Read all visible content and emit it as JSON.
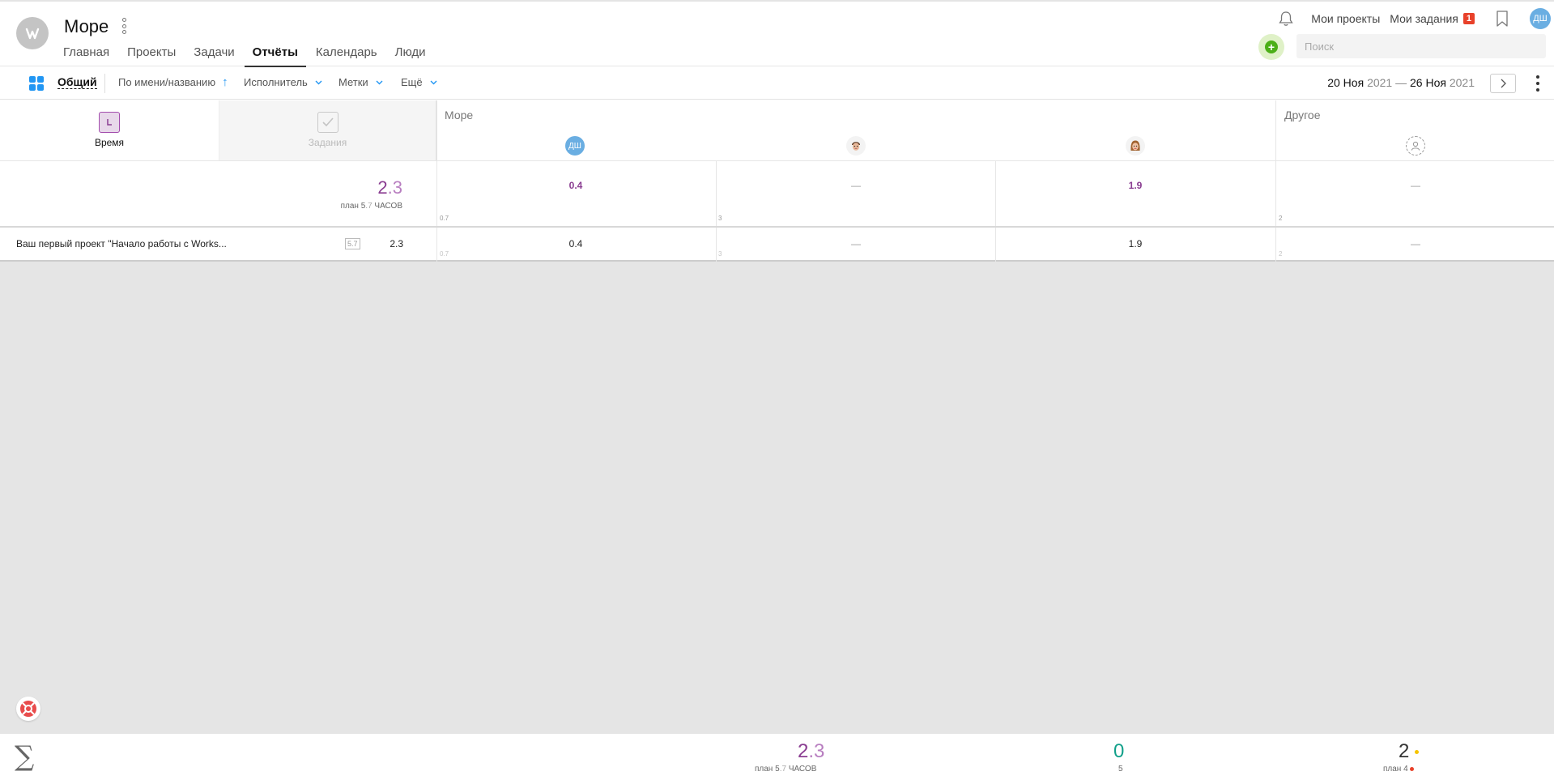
{
  "header": {
    "workspace_name": "Море",
    "nav": [
      "Главная",
      "Проекты",
      "Задачи",
      "Отчёты",
      "Календарь",
      "Люди"
    ],
    "active_nav": "Отчёты",
    "my_projects": "Мои проекты",
    "my_tasks": "Мои задания",
    "my_tasks_badge": "1",
    "user_initials": "ДШ",
    "search_placeholder": "Поиск"
  },
  "toolbar": {
    "view": "Общий",
    "sort": "По имени/названию",
    "filter_assignee": "Исполнитель",
    "filter_tags": "Метки",
    "more": "Ещё",
    "date_from_day": "20 Ноя",
    "date_from_year": "2021",
    "date_sep": "—",
    "date_to_day": "26 Ноя",
    "date_to_year": "2021"
  },
  "report": {
    "mode_time": "Время",
    "mode_tasks": "Задания",
    "group_main": "Море",
    "group_other": "Другое",
    "col_user_initials": "ДШ",
    "total_int": "2",
    "total_dec": ".3",
    "total_plan_label": "план",
    "total_plan_int": "5",
    "total_plan_dec": ".7",
    "total_unit": "ЧАСОВ",
    "summary_cells": [
      {
        "value": "0.4",
        "plan": "0.7"
      },
      {
        "value": "—",
        "plan": "3"
      },
      {
        "value": "1.9",
        "plan": ""
      },
      {
        "value": "—",
        "plan": "2"
      }
    ],
    "rows": [
      {
        "name": "Ваш первый проект \"Начало работы с Works...",
        "plan": "5.7",
        "total": "2.3",
        "cells": [
          {
            "value": "0.4",
            "plan": "0.7"
          },
          {
            "value": "—",
            "plan": "3"
          },
          {
            "value": "1.9",
            "plan": ""
          },
          {
            "value": "—",
            "plan": "2"
          }
        ]
      }
    ]
  },
  "footer": {
    "hours_int": "2",
    "hours_dec": ".3",
    "hours_plan_label": "план",
    "hours_plan_int": "5",
    "hours_plan_dec": ".7",
    "hours_unit": "ЧАСОВ",
    "done": "0",
    "done_sub": "5",
    "tasks": "2",
    "tasks_plan": "план 4"
  },
  "colors": {
    "accent_purple": "#8a3d91",
    "accent_blue": "#2196f3",
    "accent_green": "#4caf17",
    "badge_red": "#e8412a",
    "done_teal": "#12a08a"
  }
}
